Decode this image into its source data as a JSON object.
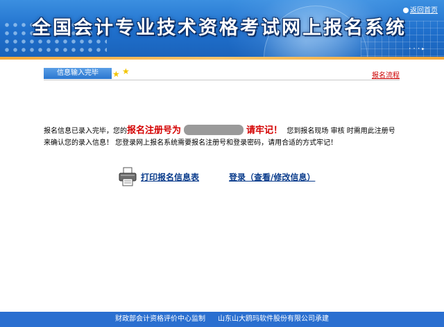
{
  "header": {
    "title": "全国会计专业技术资格考试网上报名系统",
    "return_label": "返回首页"
  },
  "steps": {
    "current_label": "信息输入完毕",
    "process_link": "报名流程"
  },
  "message": {
    "part1": "报名信息已录入完毕，您的",
    "reg_label": "报名注册号为",
    "remember": "请牢记！",
    "part2": "您到报名现场 审核 时需用此注册号来确认您的录入信息！ 您登录网上报名系统需要报名注册号和登录密码，请用合适的方式牢记！"
  },
  "actions": {
    "print_label": "打印报名信息表",
    "login_label": "登录（查看/修改信息）"
  },
  "footer": {
    "supervisor": "财政部会计资格评价中心监制",
    "developer": "山东山大鸥玛软件股份有限公司承建"
  },
  "colors": {
    "banner_blue": "#1f6fcc",
    "accent_orange": "#f3a83a",
    "alert_red": "#d40000",
    "link_blue": "#0a3c8c",
    "footer_blue": "#2a6fd0"
  },
  "icons": [
    "return-icon",
    "star-icon",
    "printer-icon"
  ]
}
